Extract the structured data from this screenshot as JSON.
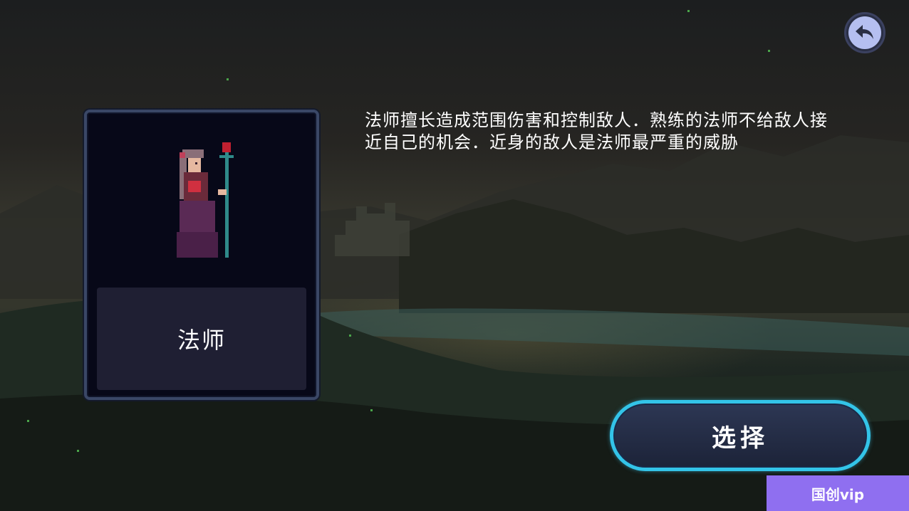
{
  "character": {
    "name": "法师",
    "description": "法师擅长造成范围伤害和控制敌人．熟练的法师不给敌人接近自己的机会．近身的敌人是法师最严重的威胁"
  },
  "buttons": {
    "select_label": "选择",
    "back_icon": "back-arrow-icon"
  },
  "watermark": {
    "text": "国创vip"
  },
  "colors": {
    "select_border": "#33c4e8",
    "card_border": "#3a4766",
    "back_button": "#b5bff0",
    "watermark_bg": "#8f6ff0"
  }
}
